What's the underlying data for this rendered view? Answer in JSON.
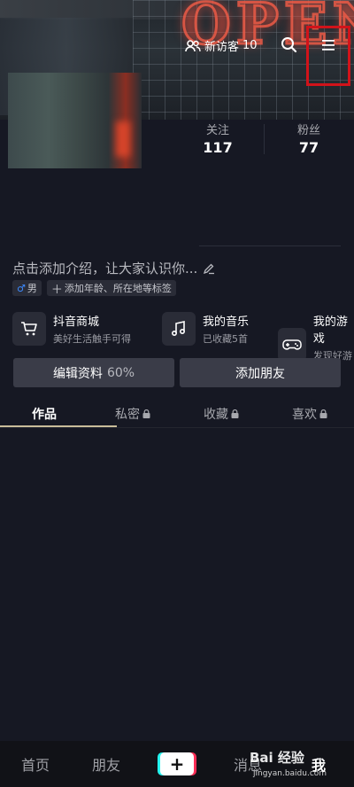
{
  "header": {
    "visitor_label": "新访客",
    "visitor_count": "10"
  },
  "stats": [
    {
      "label": "关注",
      "value": "117"
    },
    {
      "label": "粉丝",
      "value": "77"
    }
  ],
  "bio": {
    "text": "点击添加介绍，让大家认识你..."
  },
  "tags": {
    "gender_symbol": "♂",
    "gender": "男",
    "add_tag": "添加年龄、所在地等标签"
  },
  "quick_links": [
    {
      "title": "抖音商城",
      "subtitle": "美好生活触手可得",
      "icon": "cart-icon"
    },
    {
      "title": "我的音乐",
      "subtitle": "已收藏5首",
      "icon": "music-note-icon"
    },
    {
      "title": "我的游戏",
      "subtitle": "发现好游戏",
      "icon": "gamepad-icon"
    }
  ],
  "buttons": {
    "edit_profile": "编辑资料",
    "edit_progress": "60%",
    "add_friend": "添加朋友"
  },
  "tabs": [
    {
      "label": "作品",
      "locked": false
    },
    {
      "label": "私密",
      "locked": true
    },
    {
      "label": "收藏",
      "locked": true
    },
    {
      "label": "喜欢",
      "locked": true
    }
  ],
  "bottom_nav": {
    "home": "首页",
    "friends": "朋友",
    "create": "+",
    "messages": "消息",
    "me": "我"
  },
  "watermark": {
    "line1": "Bai 经验",
    "line2": "jingyan.baidu.com"
  },
  "colors": {
    "background": "#161823",
    "highlight_box": "#d1131a",
    "tab_underline": "#c8bc9a"
  }
}
